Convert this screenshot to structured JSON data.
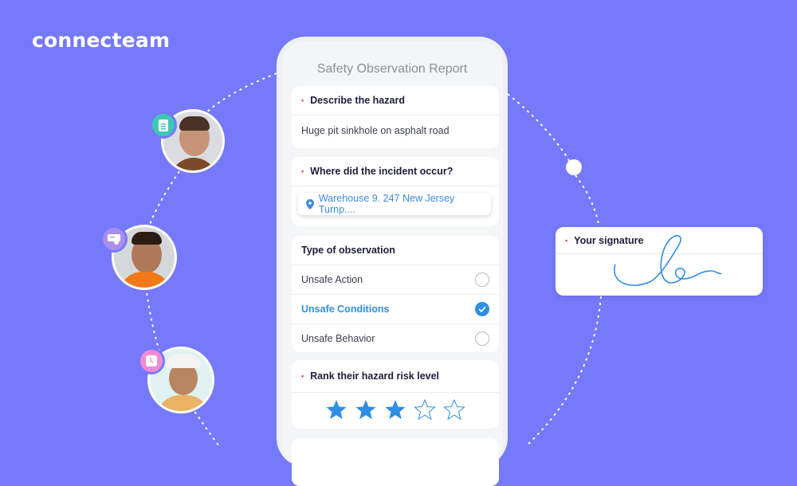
{
  "brand": {
    "logo_text": "connecteam",
    "background": "#7679F9",
    "accent": "#2f8ee6"
  },
  "form": {
    "title": "Safety Observation Report",
    "hazard": {
      "label": "Describe the hazard",
      "required": true,
      "value": "Huge pit sinkhole on asphalt road"
    },
    "location": {
      "label": "Where did the incident occur?",
      "required": true,
      "value": "Warehouse 9. 247 New Jersey Turnp...."
    },
    "observation_type": {
      "label": "Type of observation",
      "options": [
        {
          "label": "Unsafe Action",
          "selected": false
        },
        {
          "label": "Unsafe Conditions",
          "selected": true
        },
        {
          "label": "Unsafe Behavior",
          "selected": false
        }
      ]
    },
    "risk": {
      "label": "Rank their hazard risk level",
      "required": true,
      "rating": 3,
      "max": 5
    }
  },
  "signature": {
    "label": "Your signature",
    "required": true
  },
  "people": [
    {
      "badge_icon": "document-icon",
      "badge_color": "#3cc8b4"
    },
    {
      "badge_icon": "certificate-icon",
      "badge_color": "#a98df0"
    },
    {
      "badge_icon": "clock-icon",
      "badge_color": "#f28ad6"
    }
  ],
  "required_marker": "•"
}
